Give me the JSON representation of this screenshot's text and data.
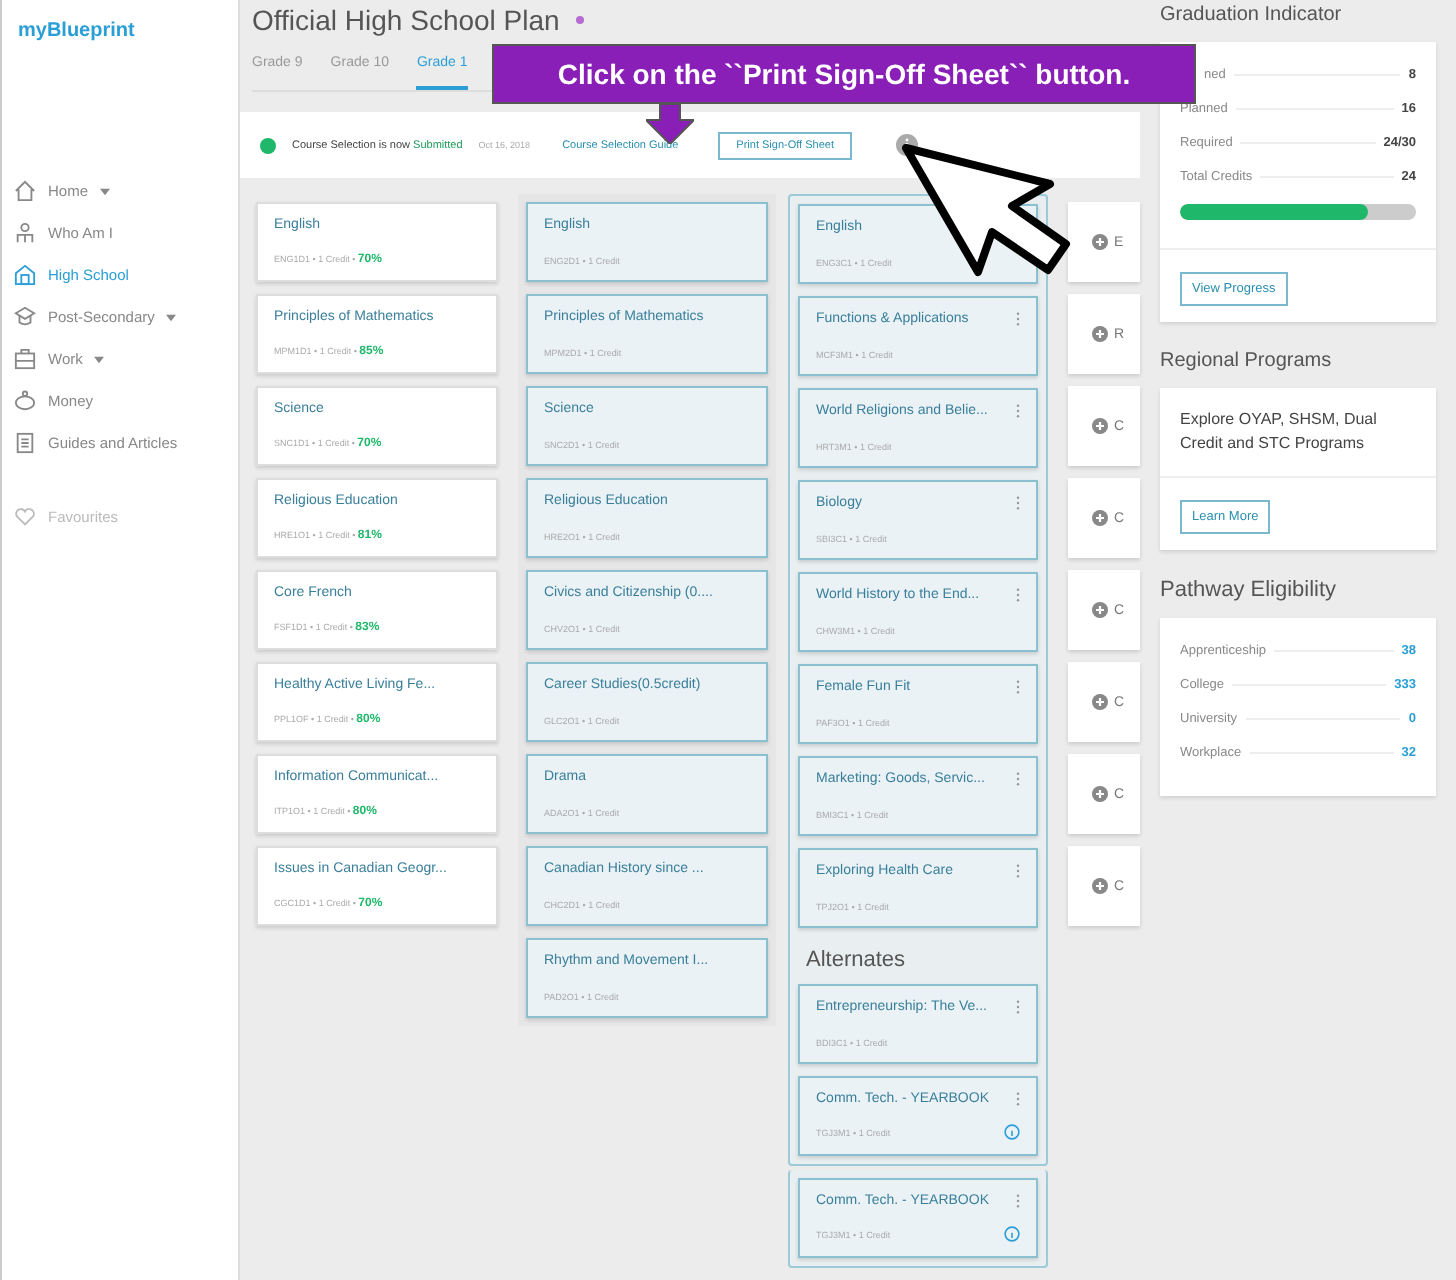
{
  "brand": "myBlueprint",
  "sidebar": {
    "items": [
      {
        "label": "Home",
        "dropdown": true,
        "selected": false
      },
      {
        "label": "Who Am I",
        "dropdown": false,
        "selected": false
      },
      {
        "label": "High School",
        "dropdown": false,
        "selected": true
      },
      {
        "label": "Post-Secondary",
        "dropdown": true,
        "selected": false
      },
      {
        "label": "Work",
        "dropdown": true,
        "selected": false
      },
      {
        "label": "Money",
        "dropdown": false,
        "selected": false
      },
      {
        "label": "Guides and Articles",
        "dropdown": false,
        "selected": false
      }
    ],
    "favourites": "Favourites"
  },
  "title": "Official High School Plan",
  "tabs": [
    {
      "label": "Grade 9",
      "selected": false
    },
    {
      "label": "Grade 10",
      "selected": false
    },
    {
      "label": "Grade 1",
      "selected": true
    }
  ],
  "status": {
    "text": "Course Selection is now",
    "state": "Submitted",
    "date": "Oct 16, 2018",
    "guide_link": "Course Selection Guide",
    "print_button": "Print Sign-Off Sheet"
  },
  "columns": [
    {
      "kind": "completed",
      "courses": [
        {
          "title": "English",
          "code": "ENG1D1 • 1 Credit •",
          "grade": "70%"
        },
        {
          "title": "Principles of Mathematics",
          "code": "MPM1D1 • 1 Credit •",
          "grade": "85%"
        },
        {
          "title": "Science",
          "code": "SNC1D1 • 1 Credit •",
          "grade": "70%"
        },
        {
          "title": "Religious Education",
          "code": "HRE1O1 • 1 Credit •",
          "grade": "81%"
        },
        {
          "title": "Core French",
          "code": "FSF1D1 • 1 Credit •",
          "grade": "83%"
        },
        {
          "title": "Healthy Active Living Fe...",
          "code": "PPL1OF • 1 Credit •",
          "grade": "80%"
        },
        {
          "title": "Information Communicat...",
          "code": "ITP1O1 • 1 Credit •",
          "grade": "80%"
        },
        {
          "title": "Issues in Canadian Geogr...",
          "code": "CGC1D1 • 1 Credit •",
          "grade": "70%"
        }
      ]
    },
    {
      "kind": "planned",
      "courses": [
        {
          "title": "English",
          "code": "ENG2D1 • 1 Credit"
        },
        {
          "title": "Principles of Mathematics",
          "code": "MPM2D1 • 1 Credit"
        },
        {
          "title": "Science",
          "code": "SNC2D1 • 1 Credit"
        },
        {
          "title": "Religious Education",
          "code": "HRE2O1 • 1 Credit"
        },
        {
          "title": "Civics and Citizenship (0....",
          "code": "CHV2O1 • 1 Credit"
        },
        {
          "title": "Career Studies(0.5credit)",
          "code": "GLC2O1 • 1 Credit"
        },
        {
          "title": "Drama",
          "code": "ADA2O1 • 1 Credit"
        },
        {
          "title": "Canadian History since ...",
          "code": "CHC2D1 • 1 Credit"
        },
        {
          "title": "Rhythm and Movement I...",
          "code": "PAD2O1 • 1 Credit"
        }
      ]
    },
    {
      "kind": "current",
      "courses": [
        {
          "title": "English",
          "code": "ENG3C1 • 1 Credit"
        },
        {
          "title": "Functions & Applications",
          "code": "MCF3M1 • 1 Credit",
          "menu": true
        },
        {
          "title": "World Religions and Belie...",
          "code": "HRT3M1 • 1 Credit",
          "menu": true
        },
        {
          "title": "Biology",
          "code": "SBI3C1 • 1 Credit",
          "menu": true
        },
        {
          "title": "World History to the End...",
          "code": "CHW3M1 • 1 Credit",
          "menu": true
        },
        {
          "title": "Female Fun Fit",
          "code": "PAF3O1 • 1 Credit",
          "menu": true
        },
        {
          "title": "Marketing: Goods, Servic...",
          "code": "BMI3C1 • 1 Credit",
          "menu": true
        },
        {
          "title": "Exploring Health Care",
          "code": "TPJ2O1 • 1 Credit",
          "menu": true
        }
      ],
      "alternates_heading": "Alternates",
      "alternates": [
        {
          "title": "Entrepreneurship: The Ve...",
          "code": "BDI3C1 • 1 Credit",
          "menu": true,
          "info": false
        },
        {
          "title": "Comm. Tech. - YEARBOOK",
          "code": "TGJ3M1 • 1 Credit",
          "menu": true,
          "info": true
        }
      ],
      "extra": [
        {
          "title": "Comm. Tech. - YEARBOOK",
          "code": "TGJ3M1 • 1 Credit",
          "menu": true,
          "info": true
        }
      ]
    },
    {
      "kind": "add",
      "courses": [
        {
          "title": "E"
        },
        {
          "title": "R"
        },
        {
          "title": "C"
        },
        {
          "title": "C"
        },
        {
          "title": "C"
        },
        {
          "title": "C"
        },
        {
          "title": "C"
        },
        {
          "title": "C"
        }
      ]
    }
  ],
  "graduation": {
    "heading": "Graduation Indicator",
    "rows": [
      {
        "label": "ned",
        "value": "8"
      },
      {
        "label": "Planned",
        "value": "16"
      },
      {
        "label": "Required",
        "value": "24/30"
      },
      {
        "label": "Total Credits",
        "value": "24"
      }
    ],
    "level": 0.8,
    "button": "View Progress"
  },
  "regional": {
    "heading": "Regional Programs",
    "text": "Explore OYAP, SHSM, Dual Credit and STC Programs",
    "button": "Learn More"
  },
  "pathway": {
    "heading": "Pathway Eligibility",
    "rows": [
      {
        "label": "Apprenticeship",
        "value": "38"
      },
      {
        "label": "College",
        "value": "333"
      },
      {
        "label": "University",
        "value": "0"
      },
      {
        "label": "Workplace",
        "value": "32"
      }
    ]
  },
  "tooltip": "Click on the ``Print Sign-Off Sheet`` button."
}
